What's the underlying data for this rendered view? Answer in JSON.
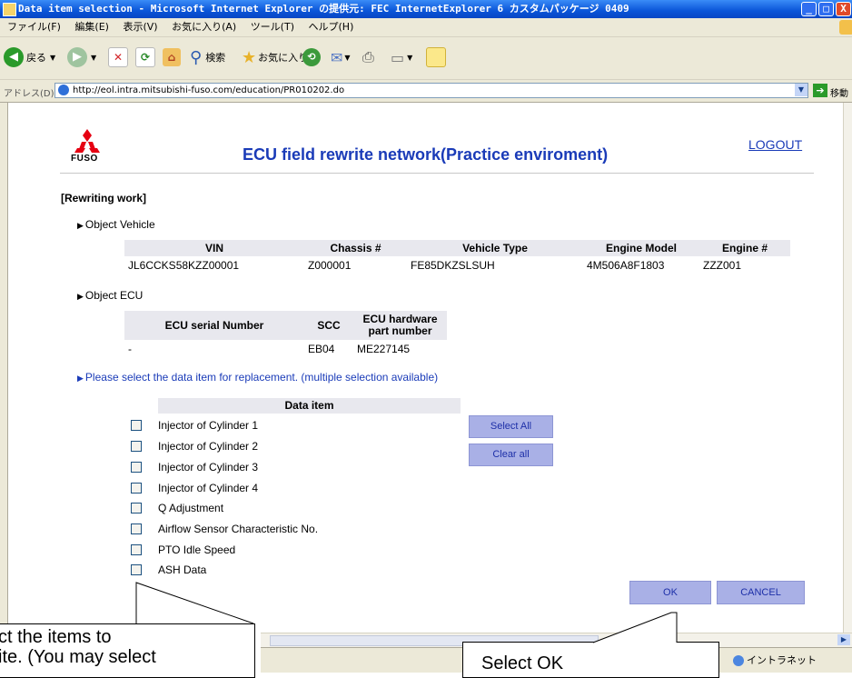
{
  "window": {
    "title": "Data item selection - Microsoft Internet Explorer の提供元: FEC InternetExplorer 6 カスタムパッケージ 0409",
    "minimize_label": "_",
    "maximize_label": "□",
    "close_label": "X"
  },
  "menu": [
    "ファイル(F)",
    "編集(E)",
    "表示(V)",
    "お気に入り(A)",
    "ツール(T)",
    "ヘルプ(H)"
  ],
  "toolbar": {
    "back_label": "戻る",
    "search_label": "検索",
    "favorites_label": "お気に入り"
  },
  "address": {
    "label": "アドレス(D)",
    "url": "http://eol.intra.mitsubishi-fuso.com/education/PR010202.do",
    "go_label": "移動"
  },
  "status": {
    "zone": "イントラネット"
  },
  "page": {
    "logo_text": "FUSO",
    "title": "ECU field rewrite network(Practice enviroment)",
    "logout": "LOGOUT",
    "section": "[Rewriting work]",
    "object_vehicle": "Object Vehicle",
    "object_ecu": "Object ECU",
    "select_prompt": "Please select the data item for replacement. (multiple selection available)"
  },
  "vehicle_table": {
    "headers": [
      "VIN",
      "Chassis #",
      "Vehicle Type",
      "Engine Model",
      "Engine #"
    ],
    "row": [
      "JL6CCKS58KZZ00001",
      "Z000001",
      "FE85DKZSLSUH",
      "4M506A8F1803",
      "ZZZ001"
    ]
  },
  "ecu_table": {
    "headers": [
      "ECU serial Number",
      "SCC",
      "ECU hardware",
      "part number"
    ],
    "row": [
      "-",
      "EB04",
      "ME227145"
    ]
  },
  "data_items": {
    "header": "Data item",
    "items": [
      "Injector of Cylinder 1",
      "Injector of Cylinder 2",
      "Injector of Cylinder 3",
      "Injector of Cylinder 4",
      "Q Adjustment",
      "Airflow Sensor Characteristic No.",
      "PTO Idle Speed",
      "ASH Data"
    ]
  },
  "buttons": {
    "select_all": "Select All",
    "clear_all": "Clear all",
    "ok": "OK",
    "cancel": "CANCEL"
  },
  "callouts": {
    "left_line1": "ct the items to",
    "left_line2": "ite.  (You may select",
    "right": "Select OK"
  }
}
